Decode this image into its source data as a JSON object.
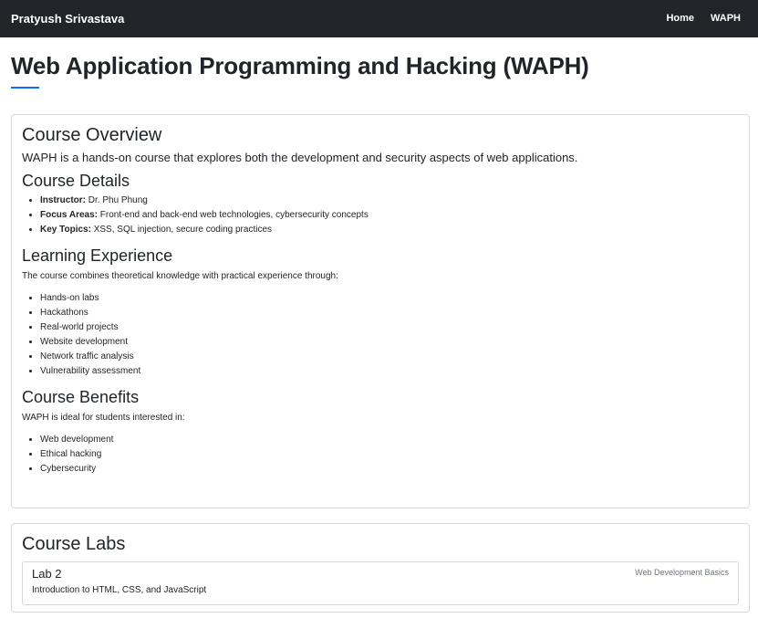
{
  "navbar": {
    "brand": "Pratyush Srivastava",
    "links": [
      "Home",
      "WAPH"
    ]
  },
  "page": {
    "title": "Web Application Programming and Hacking (WAPH)",
    "accent_color": "#0d6efd"
  },
  "overview": {
    "title": "Course Overview",
    "lead": "WAPH is a hands-on course that explores both the development and security aspects of web applications.",
    "details": {
      "title": "Course Details",
      "items": [
        {
          "label": "Instructor:",
          "value": "Dr. Phu Phung"
        },
        {
          "label": "Focus Areas:",
          "value": "Front-end and back-end web technologies, cybersecurity concepts"
        },
        {
          "label": "Key Topics:",
          "value": "XSS, SQL injection, secure coding practices"
        }
      ]
    },
    "learning": {
      "title": "Learning Experience",
      "intro": "The course combines theoretical knowledge with practical experience through:",
      "items": [
        "Hands-on labs",
        "Hackathons",
        "Real-world projects",
        "Website development",
        "Network traffic analysis",
        "Vulnerability assessment"
      ]
    },
    "benefits": {
      "title": "Course Benefits",
      "intro": "WAPH is ideal for students interested in:",
      "items": [
        "Web development",
        "Ethical hacking",
        "Cybersecurity"
      ]
    }
  },
  "labs": {
    "title": "Course Labs",
    "items": [
      {
        "title": "Lab 2",
        "tag": "Web Development Basics",
        "description": "Introduction to HTML, CSS, and JavaScript"
      }
    ]
  }
}
